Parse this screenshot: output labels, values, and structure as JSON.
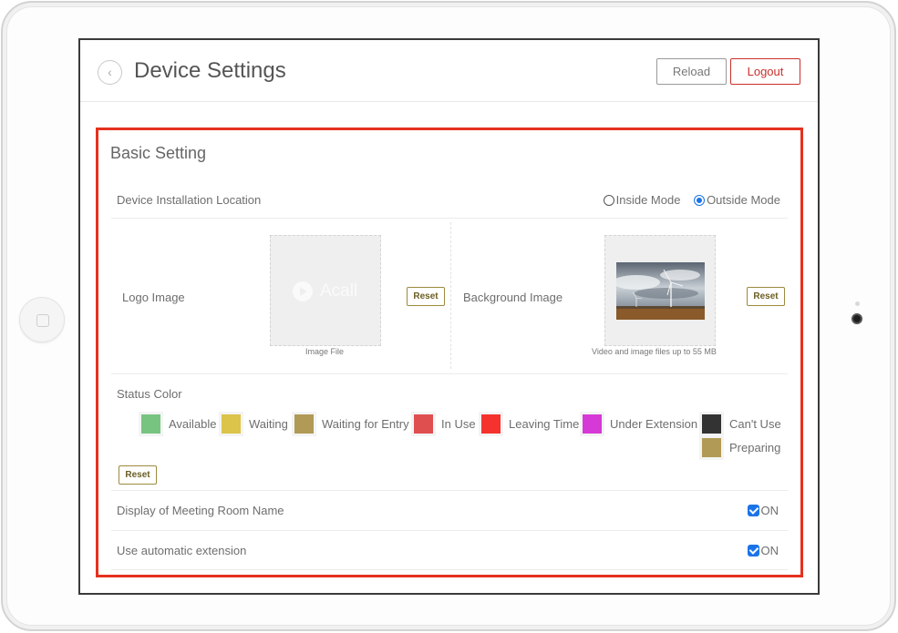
{
  "header": {
    "back_icon": "chevron-left-icon",
    "title": "Device Settings",
    "reload_label": "Reload",
    "logout_label": "Logout"
  },
  "basic_setting": {
    "title": "Basic Setting",
    "installation": {
      "label": "Device Installation Location",
      "options": [
        {
          "label": "Inside Mode",
          "selected": false
        },
        {
          "label": "Outside Mode",
          "selected": true
        }
      ]
    },
    "logo_image": {
      "label": "Logo Image",
      "placeholder_logo_text": "Acall",
      "caption": "Image File",
      "reset_label": "Reset"
    },
    "background_image": {
      "label": "Background Image",
      "caption": "Video and image files up to 55 MB",
      "reset_label": "Reset"
    },
    "status_color": {
      "label": "Status Color",
      "reset_label": "Reset",
      "items": [
        {
          "label": "Available",
          "color": "#77c481"
        },
        {
          "label": "Waiting",
          "color": "#dcc34a"
        },
        {
          "label": "Waiting for Entry",
          "color": "#b09a55"
        },
        {
          "label": "In Use",
          "color": "#e04f4f"
        },
        {
          "label": "Leaving Time",
          "color": "#f5322e"
        },
        {
          "label": "Under Extension",
          "color": "#d63ad6"
        },
        {
          "label": "Can't Use",
          "color": "#333333"
        },
        {
          "label": "Preparing",
          "color": "#b09a55"
        }
      ]
    },
    "display_room_name": {
      "label": "Display of Meeting Room Name",
      "value": "ON",
      "checked": true
    },
    "auto_extension": {
      "label": "Use automatic extension",
      "value": "ON",
      "checked": true
    }
  }
}
